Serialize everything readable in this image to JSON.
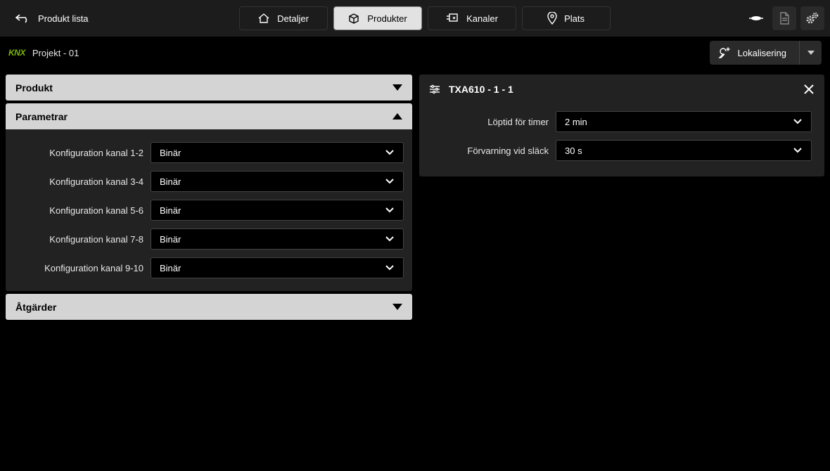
{
  "topbar": {
    "back": "Produkt lista",
    "tabs": [
      {
        "label": "Detaljer"
      },
      {
        "label": "Produkter"
      },
      {
        "label": "Kanaler"
      },
      {
        "label": "Plats"
      }
    ]
  },
  "project": {
    "name": "Projekt - 01"
  },
  "localize_btn": "Lokalisering",
  "left": {
    "product_header": "Produkt",
    "params_header": "Parametrar",
    "actions_header": "Åtgärder",
    "params": [
      {
        "label": "Konfiguration kanal 1-2",
        "value": "Binär"
      },
      {
        "label": "Konfiguration kanal 3-4",
        "value": "Binär"
      },
      {
        "label": "Konfiguration kanal 5-6",
        "value": "Binär"
      },
      {
        "label": "Konfiguration kanal 7-8",
        "value": "Binär"
      },
      {
        "label": "Konfiguration kanal 9-10",
        "value": "Binär"
      }
    ]
  },
  "right": {
    "title": "TXA610 - 1 - 1",
    "rows": [
      {
        "label": "Löptid för timer",
        "value": "2 min"
      },
      {
        "label": "Förvarning vid släck",
        "value": "30 s"
      }
    ]
  }
}
